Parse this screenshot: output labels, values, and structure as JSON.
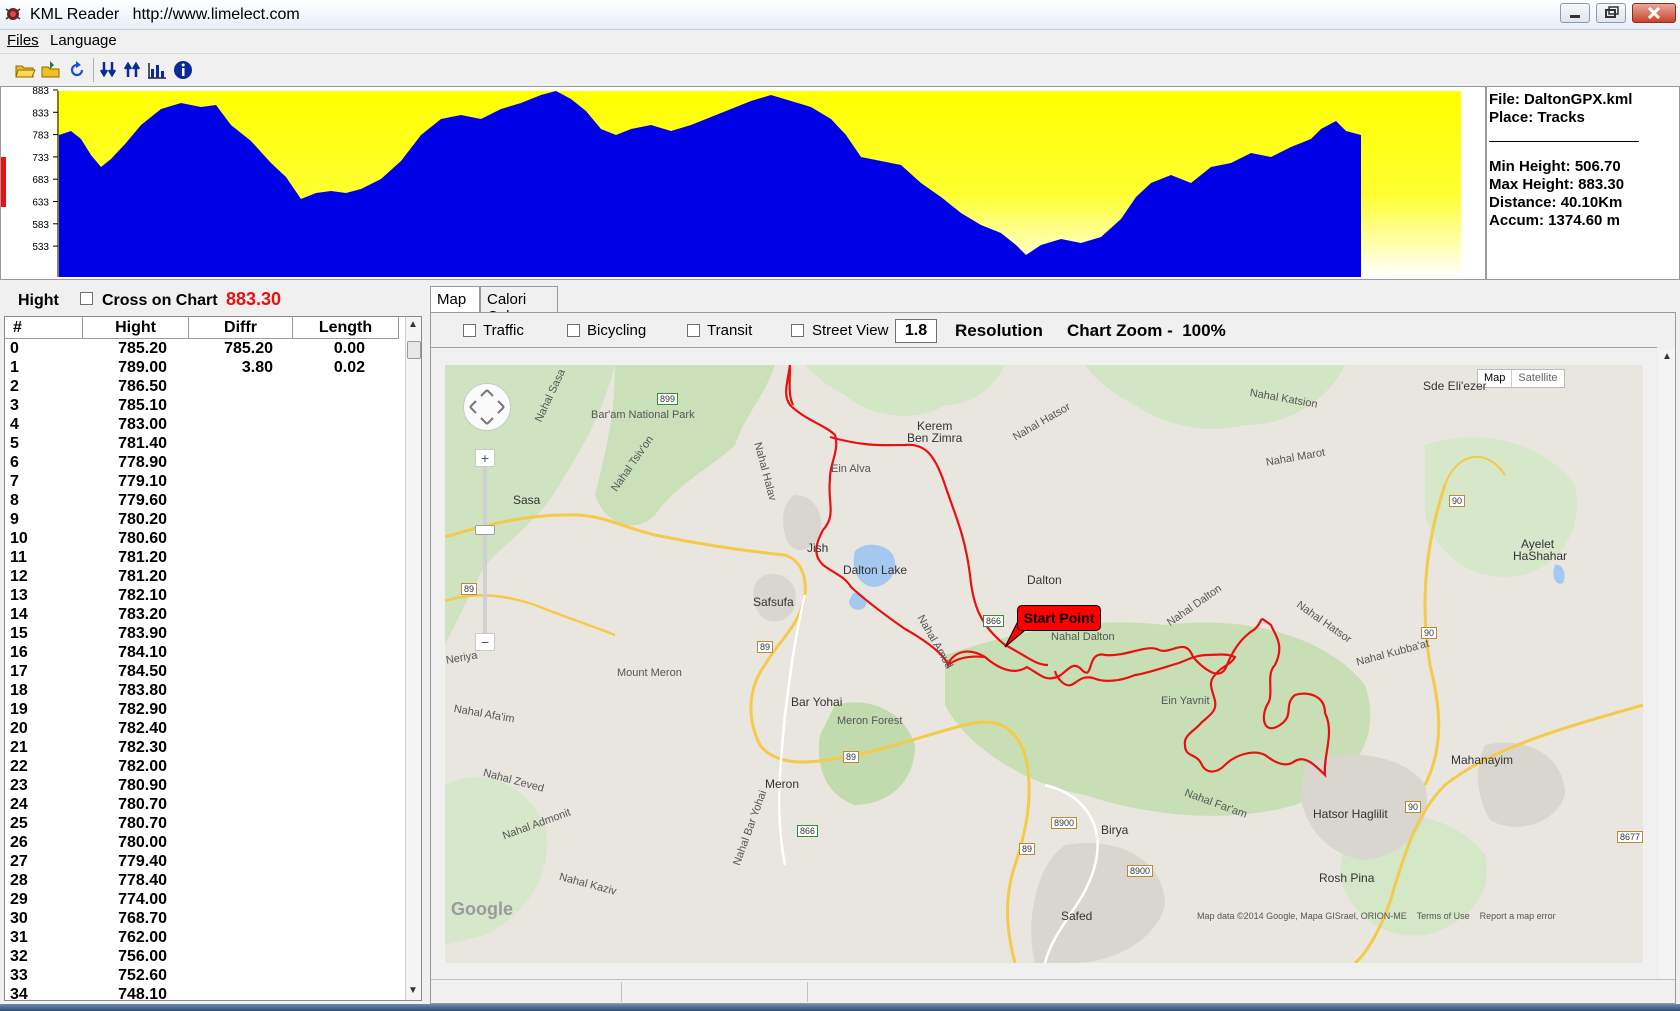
{
  "window": {
    "title": "KML Reader",
    "url": "http://www.limelect.com"
  },
  "menu": {
    "files": "Files",
    "language": "Language"
  },
  "toolbar": {
    "icons": [
      "open-folder-icon",
      "open-kml-icon",
      "refresh-icon",
      "arrow-down-icon",
      "arrow-up-icon",
      "chart-icon",
      "info-icon"
    ]
  },
  "elevation_chart": {
    "y_ticks": [
      "883",
      "833",
      "783",
      "733",
      "683",
      "633",
      "583",
      "533"
    ],
    "fill_color": "#0000e6",
    "background_top": "#ffff00",
    "background_bottom": "#ffffff"
  },
  "info": {
    "file": "File: DaltonGPX.kml",
    "place": "Place: Tracks",
    "min_height": "Min Height: 506.70",
    "max_height": "Max Height: 883.30",
    "distance": "Distance: 40.10Km",
    "accum": "Accum: 1374.60 m"
  },
  "left_panel": {
    "title": "Hight",
    "cross_label": "Cross on Chart",
    "current_value": "883.30",
    "columns": [
      "#",
      "Hight",
      "Diffr",
      "Length"
    ],
    "rows": [
      [
        "0",
        "785.20",
        "785.20",
        "0.00"
      ],
      [
        "1",
        "789.00",
        "3.80",
        "0.02"
      ],
      [
        "2",
        "786.50",
        "",
        ""
      ],
      [
        "3",
        "785.10",
        "",
        ""
      ],
      [
        "4",
        "783.00",
        "",
        ""
      ],
      [
        "5",
        "781.40",
        "",
        ""
      ],
      [
        "6",
        "778.90",
        "",
        ""
      ],
      [
        "7",
        "779.10",
        "",
        ""
      ],
      [
        "8",
        "779.60",
        "",
        ""
      ],
      [
        "9",
        "780.20",
        "",
        ""
      ],
      [
        "10",
        "780.60",
        "",
        ""
      ],
      [
        "11",
        "781.20",
        "",
        ""
      ],
      [
        "12",
        "781.20",
        "",
        ""
      ],
      [
        "13",
        "782.10",
        "",
        ""
      ],
      [
        "14",
        "783.20",
        "",
        ""
      ],
      [
        "15",
        "783.90",
        "",
        ""
      ],
      [
        "16",
        "784.10",
        "",
        ""
      ],
      [
        "17",
        "784.50",
        "",
        ""
      ],
      [
        "18",
        "783.80",
        "",
        ""
      ],
      [
        "19",
        "782.90",
        "",
        ""
      ],
      [
        "20",
        "782.40",
        "",
        ""
      ],
      [
        "21",
        "782.30",
        "",
        ""
      ],
      [
        "22",
        "782.00",
        "",
        ""
      ],
      [
        "23",
        "780.90",
        "",
        ""
      ],
      [
        "24",
        "780.70",
        "",
        ""
      ],
      [
        "25",
        "780.70",
        "",
        ""
      ],
      [
        "26",
        "780.00",
        "",
        ""
      ],
      [
        "27",
        "779.40",
        "",
        ""
      ],
      [
        "28",
        "778.40",
        "",
        ""
      ],
      [
        "29",
        "774.00",
        "",
        ""
      ],
      [
        "30",
        "768.70",
        "",
        ""
      ],
      [
        "31",
        "762.00",
        "",
        ""
      ],
      [
        "32",
        "756.00",
        "",
        ""
      ],
      [
        "33",
        "752.60",
        "",
        ""
      ],
      [
        "34",
        "748.10",
        "",
        ""
      ]
    ]
  },
  "tabs": [
    "Map",
    "Calori Calc"
  ],
  "map_options": {
    "traffic": "Traffic",
    "bicycling": "Bicycling",
    "transit": "Transit",
    "street_view": "Street View",
    "resolution_value": "1.8",
    "resolution_label": "Resolution",
    "chart_zoom": "Chart Zoom -  100%"
  },
  "map": {
    "type_map": "Map",
    "type_satellite": "Satellite",
    "start_point": "Start Point",
    "google": "Google",
    "attribution": "Map data ©2014 Google, Mapa GISrael, ORION-ME    Terms of Use    Report a map error",
    "labels": {
      "sde_eliezer": "Sde Eli'ezer",
      "nahal_katsion": "Nahal Katsion",
      "baram": "Bar'am National Park",
      "kerem": "Kerem",
      "ben_zimra": "Ben Zimra",
      "nahal_hatsor1": "Nahal Hatsor",
      "nahal_marot": "Nahal Marot",
      "nahal_sasa": "Nahal Sasa",
      "nahal_halav": "Nahal Halav",
      "ein_alva": "Ein Alva",
      "sasa": "Sasa",
      "nahal_tsivon": "Nahal Tsiv'on",
      "jish": "Jish",
      "dalton_lake": "Dalton Lake",
      "dalton": "Dalton",
      "ayelet": "Ayelet",
      "hashahar": "HaShahar",
      "safsufa": "Safsufa",
      "nahal_amud": "Nahal Amud",
      "nahal_dalton1": "Nahal Dalton",
      "nahal_dalton2": "Nahal Dalton",
      "nahal_hatsor2": "Nahal Hatsor",
      "nahal_kubbaat": "Nahal Kubba'at",
      "neriya": "Neriya",
      "mount_meron": "Mount Meron",
      "ein_yavnit": "Ein Yavnit",
      "nahal_afaim": "Nahal Afa'im",
      "bar_yohai": "Bar Yohai",
      "meron_forest": "Meron Forest",
      "mahanayim": "Mahanayim",
      "nahal_zeved": "Nahal Zeved",
      "meron": "Meron",
      "nahal_faram": "Nahal Far'am",
      "biriya": "Birya",
      "hatsor_haglilit": "Hatsor Haglilit",
      "nahal_admonit": "Nahal Admonit",
      "nahal_bar_yohai": "Nahal Bar Yohai",
      "nahal_kaziv": "Nahal Kaziv",
      "rosh_pina": "Rosh Pina",
      "safed": "Safed"
    },
    "roads": [
      "899",
      "89",
      "89",
      "89",
      "866",
      "866",
      "90",
      "90",
      "90",
      "89",
      "8900",
      "8900",
      "8677"
    ]
  }
}
